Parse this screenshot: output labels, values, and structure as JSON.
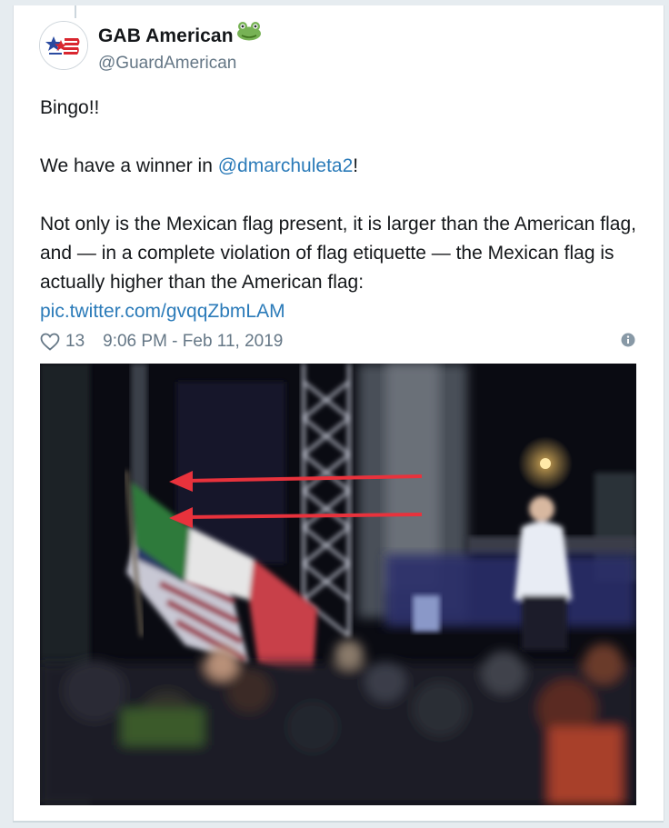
{
  "tweet": {
    "display_name": "GAB American",
    "handle": "@GuardAmerican",
    "paragraph_1": "Bingo!!",
    "paragraph_2_prefix": "We have a winner in ",
    "paragraph_2_mention": "@dmarchuleta2",
    "paragraph_2_suffix": "!",
    "paragraph_3": "Not only is the Mexican flag present, it is larger than the American flag, and — in a complete violation of flag etiquette — the Mexican flag is actually higher than the American flag:",
    "pic_link": "pic.twitter.com/gvqqZbmLAM",
    "like_count": "13",
    "timestamp": "9:06 PM - Feb 11, 2019"
  },
  "icons": {
    "avatar": "flag-star-logo",
    "name_emoji": "frog-icon",
    "like": "heart-outline-icon",
    "info": "info-circle-icon"
  },
  "colors": {
    "link": "#2b7bb9",
    "secondary_text": "#657786",
    "arrow": "#e8323c"
  }
}
